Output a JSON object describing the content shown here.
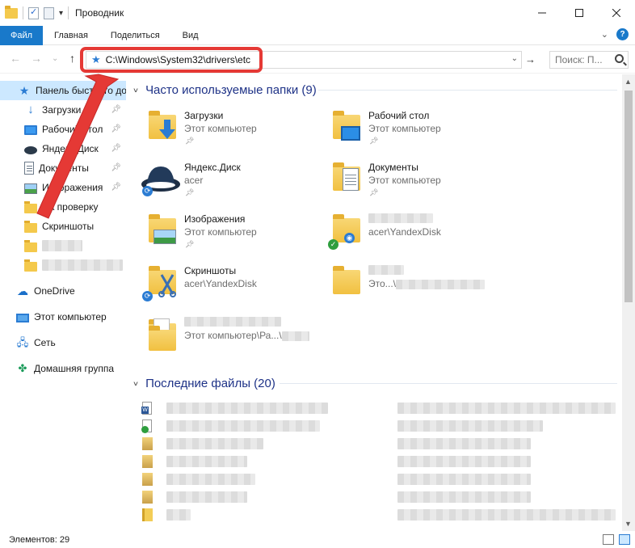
{
  "window": {
    "title": "Проводник",
    "minimize_icon": "minimize-icon",
    "maximize_icon": "maximize-icon",
    "close_icon": "close-icon"
  },
  "ribbon": {
    "tabs": [
      "Файл",
      "Главная",
      "Поделиться",
      "Вид"
    ]
  },
  "address": {
    "path": "C:\\Windows\\System32\\drivers\\etc",
    "highlight_color": "#e53935"
  },
  "search": {
    "placeholder": "Поиск: П..."
  },
  "sidebar": {
    "quick_access": "Панель быстрого доступа",
    "items": [
      {
        "label": "Загрузки",
        "icon": "download-icon",
        "pinned": true
      },
      {
        "label": "Рабочий стол",
        "icon": "desktop-icon",
        "pinned": true
      },
      {
        "label": "Яндекс.Диск",
        "icon": "yandex-disk-icon",
        "pinned": true
      },
      {
        "label": "Документы",
        "icon": "documents-icon",
        "pinned": true
      },
      {
        "label": "Изображения",
        "icon": "pictures-icon",
        "pinned": true
      },
      {
        "label": "На проверку",
        "icon": "folder-icon",
        "pinned": false
      },
      {
        "label": "Скриншоты",
        "icon": "screenshots-folder-icon",
        "pinned": false
      }
    ],
    "onedrive": "OneDrive",
    "this_pc": "Этот компьютер",
    "network": "Сеть",
    "homegroup": "Домашняя группа"
  },
  "frequent": {
    "header": "Часто используемые папки (9)",
    "tiles": [
      {
        "name": "Загрузки",
        "sub": "Этот компьютер",
        "icon": "downloads-folder-icon",
        "pinned": true
      },
      {
        "name": "Рабочий стол",
        "sub": "Этот компьютер",
        "icon": "desktop-folder-icon",
        "pinned": true
      },
      {
        "name": "Яндекс.Диск",
        "sub": "acer",
        "icon": "yandex-disk-icon",
        "pinned": true
      },
      {
        "name": "Документы",
        "sub": "Этот компьютер",
        "icon": "documents-folder-icon",
        "pinned": true
      },
      {
        "name": "Изображения",
        "sub": "Этот компьютер",
        "icon": "pictures-folder-icon",
        "pinned": true
      },
      {
        "name": "",
        "sub": "acer\\YandexDisk",
        "icon": "synced-folder-icon",
        "pinned": false
      },
      {
        "name": "Скриншоты",
        "sub": "acer\\YandexDisk",
        "icon": "screenshots-folder-icon",
        "pinned": false
      },
      {
        "name": "",
        "sub": "Это...\\",
        "icon": "folder-icon",
        "pinned": false
      },
      {
        "name": "",
        "sub": "Этот компьютер\\Ра...\\",
        "icon": "folder-files-icon",
        "pinned": false
      }
    ]
  },
  "recent": {
    "header": "Последние файлы (20)"
  },
  "status": {
    "count": "Элементов: 29"
  }
}
